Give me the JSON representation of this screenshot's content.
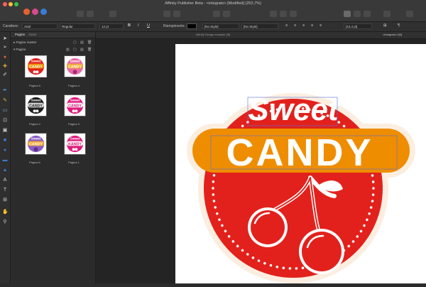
{
  "app": {
    "title": "Affinity Publisher Beta - <integrato> [Modified] (252,7%)",
    "persona_tab": "Pagine"
  },
  "context_toolbar": {
    "font_label": "Carattere:",
    "font_value": "Arial",
    "style_value": "Regular",
    "size_value": "12 pt",
    "bold": "B",
    "italic": "I",
    "underline": "U",
    "fill_label": "Riempimento:",
    "fill_color": "#000000",
    "para_style": "[No Style]",
    "char_style": "[No Style]",
    "leading_value": "[12,4 pt]"
  },
  "panel": {
    "tabs": [
      {
        "label": "Pagine",
        "active": true
      },
      {
        "label": "Asset",
        "active": false
      }
    ],
    "sections": {
      "master": "Pagine master",
      "pages": "Pagine"
    },
    "thumbnails": [
      {
        "label": "Pagina 5",
        "top": "Sweet",
        "main": "CANDY",
        "variant": "red",
        "selected": true
      },
      {
        "label": "Pagina 4",
        "top": "Sweet",
        "main": "CANDY",
        "variant": "pink",
        "selected": false
      },
      {
        "label": "Pagina 2",
        "top": "Sweet",
        "main": "CANDY",
        "variant": "black",
        "selected": false
      },
      {
        "label": "Pagina 3",
        "top": "Sweet",
        "main": "CANDY",
        "variant": "magenta",
        "selected": false
      },
      {
        "label": "Pagina 6",
        "top": "Sweet",
        "main": "CANDY",
        "variant": "purple",
        "selected": false
      },
      {
        "label": "Pagina 1",
        "top": "Sweet",
        "main": "KANDY",
        "variant": "magenta2",
        "selected": false
      }
    ]
  },
  "document_tabs": {
    "left": "Affinity Design example [M]",
    "right": "<integrato> [M]"
  },
  "artwork": {
    "top_text": "Sweet",
    "main_text": "CANDY",
    "colors": {
      "red": "#e2211c",
      "orange": "#ef8d00",
      "cream": "#fbeee0",
      "white": "#ffffff"
    }
  }
}
